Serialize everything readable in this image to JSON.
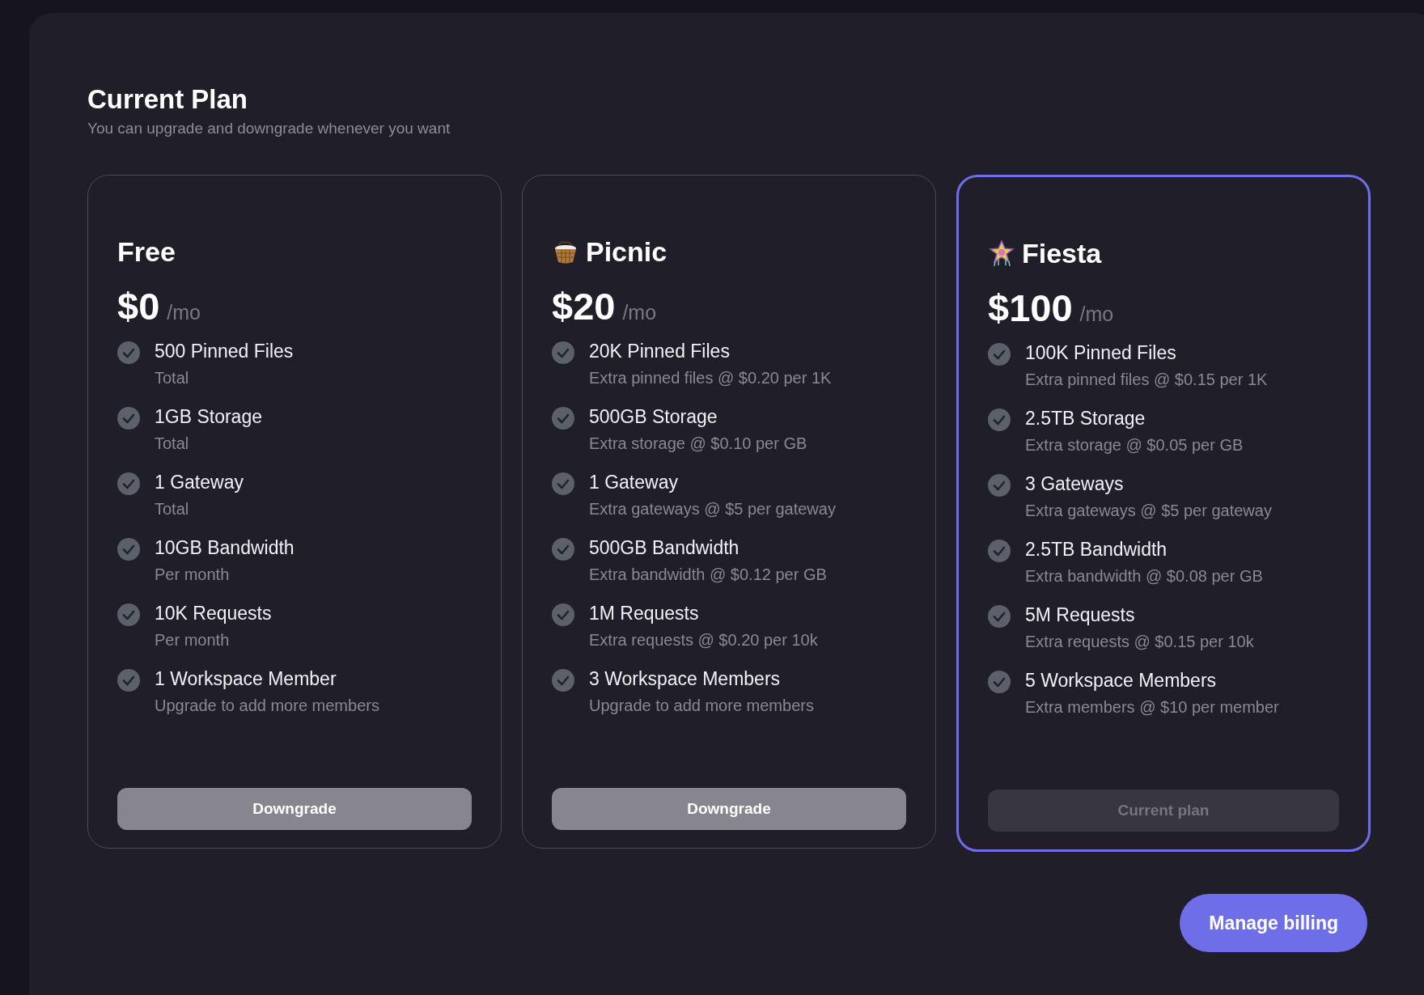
{
  "header": {
    "title": "Current Plan",
    "subtitle": "You can upgrade and downgrade whenever you want"
  },
  "plans": [
    {
      "name": "Free",
      "kind": "plain",
      "current": false,
      "price": "$0",
      "period": "/mo",
      "features": [
        {
          "title": "500 Pinned Files",
          "detail": "Total"
        },
        {
          "title": "1GB Storage",
          "detail": "Total"
        },
        {
          "title": "1 Gateway",
          "detail": "Total"
        },
        {
          "title": "10GB Bandwidth",
          "detail": "Per month"
        },
        {
          "title": "10K Requests",
          "detail": "Per month"
        },
        {
          "title": "1 Workspace Member",
          "detail": "Upgrade to add more members"
        }
      ],
      "button": {
        "label": "Downgrade",
        "disabled": false
      }
    },
    {
      "name": "Picnic",
      "kind": "basket",
      "current": false,
      "price": "$20",
      "period": "/mo",
      "features": [
        {
          "title": "20K Pinned Files",
          "detail": "Extra pinned files @ $0.20 per 1K"
        },
        {
          "title": "500GB Storage",
          "detail": "Extra storage @ $0.10 per GB"
        },
        {
          "title": "1 Gateway",
          "detail": "Extra gateways @ $5 per gateway"
        },
        {
          "title": "500GB Bandwidth",
          "detail": "Extra bandwidth @ $0.12 per GB"
        },
        {
          "title": "1M Requests",
          "detail": "Extra requests @ $0.20 per 10k"
        },
        {
          "title": "3 Workspace Members",
          "detail": "Upgrade to add more members"
        }
      ],
      "button": {
        "label": "Downgrade",
        "disabled": false
      }
    },
    {
      "name": "Fiesta",
      "kind": "pinata",
      "current": true,
      "price": "$100",
      "period": "/mo",
      "features": [
        {
          "title": "100K Pinned Files",
          "detail": "Extra pinned files @ $0.15 per 1K"
        },
        {
          "title": "2.5TB Storage",
          "detail": "Extra storage @ $0.05 per GB"
        },
        {
          "title": "3 Gateways",
          "detail": "Extra gateways @ $5 per gateway"
        },
        {
          "title": "2.5TB Bandwidth",
          "detail": "Extra bandwidth @ $0.08 per GB"
        },
        {
          "title": "5M Requests",
          "detail": "Extra requests @ $0.15 per 10k"
        },
        {
          "title": "5 Workspace Members",
          "detail": "Extra members @ $10 per member"
        }
      ],
      "button": {
        "label": "Current plan",
        "disabled": true
      }
    }
  ],
  "footer": {
    "button": "Manage billing"
  }
}
